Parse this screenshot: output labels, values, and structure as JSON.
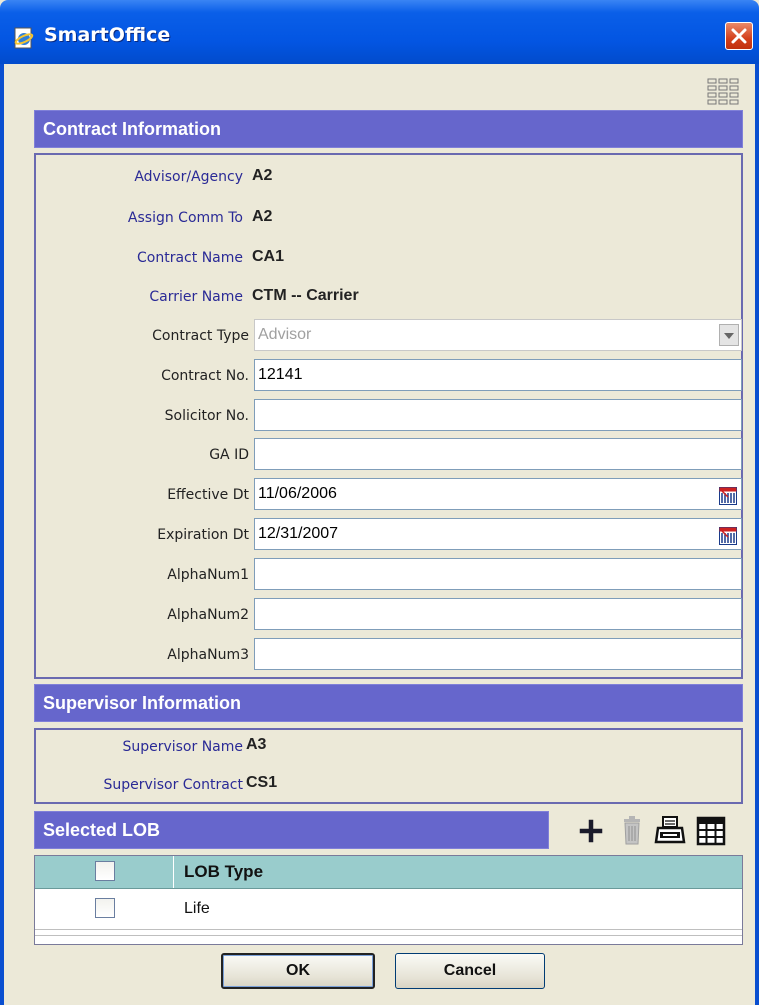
{
  "window": {
    "title": "SmartOffice"
  },
  "contract": {
    "header": "Contract Information",
    "advisor_label": "Advisor/Agency",
    "advisor_value": "A2",
    "assign_label": "Assign Comm To",
    "assign_value": "A2",
    "contract_name_label": "Contract Name",
    "contract_name_value": "CA1",
    "carrier_label": "Carrier Name",
    "carrier_value": "CTM -- Carrier",
    "contract_type_label": "Contract Type",
    "contract_type_value": "Advisor",
    "contract_no_label": "Contract No.",
    "contract_no_value": "12141",
    "solicitor_label": "Solicitor No.",
    "solicitor_value": "",
    "ga_label": "GA ID",
    "ga_value": "",
    "effective_label": "Effective Dt",
    "effective_value": "11/06/2006",
    "expiration_label": "Expiration Dt",
    "expiration_value": "12/31/2007",
    "alpha1_label": "AlphaNum1",
    "alpha1_value": "",
    "alpha2_label": "AlphaNum2",
    "alpha2_value": "",
    "alpha3_label": "AlphaNum3",
    "alpha3_value": ""
  },
  "supervisor": {
    "header": "Supervisor Information",
    "name_label": "Supervisor Name",
    "name_value": "A3",
    "contract_label": "Supervisor Contract",
    "contract_value": "CS1"
  },
  "lob": {
    "header": "Selected LOB",
    "column_header": "LOB Type",
    "rows": [
      {
        "type": "Life",
        "checked": false
      }
    ]
  },
  "buttons": {
    "ok": "OK",
    "cancel": "Cancel"
  },
  "icons": {
    "app": "ie-page-icon",
    "close": "close-icon",
    "layout": "grid-layout-icon",
    "add": "plus-icon",
    "delete": "trash-icon",
    "print": "printer-icon",
    "columns": "table-grid-icon",
    "calendar": "calendar-icon"
  },
  "colors": {
    "section_header": "#6666cc",
    "label_blue": "#2a2a96",
    "title_bar": "#0355e2",
    "lob_header": "#99cccc"
  }
}
